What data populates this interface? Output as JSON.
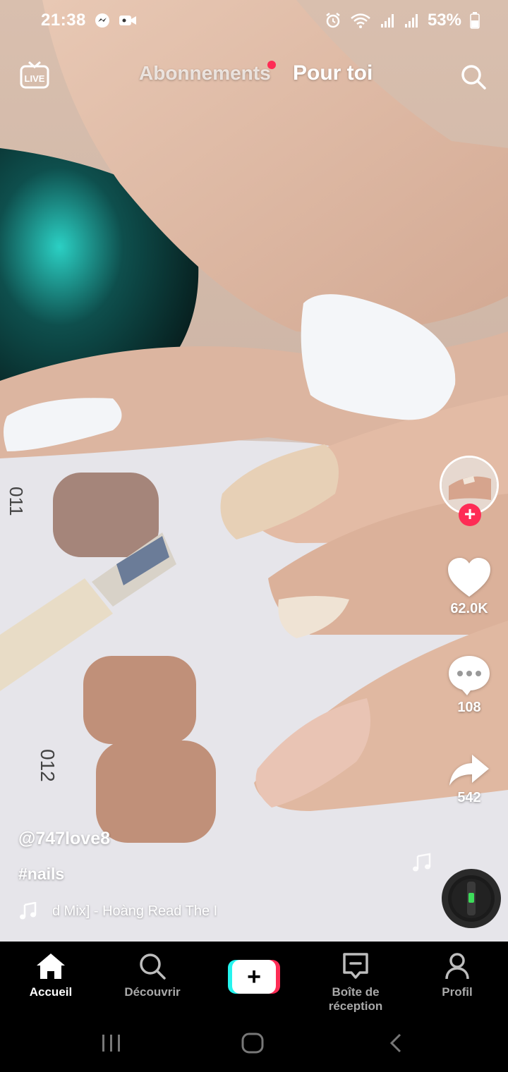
{
  "status_bar": {
    "time": "21:38",
    "battery": "53%",
    "left_icons": [
      "messenger-icon",
      "video-call-icon"
    ],
    "right_icons": [
      "alarm-icon",
      "wifi-icon",
      "signal-icon",
      "signal-icon",
      "battery-icon"
    ]
  },
  "top_nav": {
    "live_label": "LIVE",
    "tabs": [
      {
        "label": "Abonnements",
        "active": false,
        "has_dot": true
      },
      {
        "label": "Pour toi",
        "active": true
      }
    ]
  },
  "video": {
    "swatch_labels": [
      "011",
      "012"
    ]
  },
  "actions": {
    "likes": "62.0K",
    "comments": "108",
    "shares": "542"
  },
  "caption": {
    "username": "@747love8",
    "hashtag": "#nails",
    "music": "d Mix] - Hoàng Read    The I"
  },
  "bottom_tabs": [
    {
      "label": "Accueil",
      "icon": "home-icon",
      "active": true
    },
    {
      "label": "Découvrir",
      "icon": "search-icon",
      "active": false
    },
    {
      "label": "",
      "icon": "create-icon",
      "active": false
    },
    {
      "label": "Boîte de réception",
      "icon": "inbox-icon",
      "active": false
    },
    {
      "label": "Profil",
      "icon": "profile-icon",
      "active": false
    }
  ],
  "colors": {
    "accent": "#fe2c55",
    "create_cyan": "#25f4ee",
    "tabbar_bg": "#000000"
  }
}
